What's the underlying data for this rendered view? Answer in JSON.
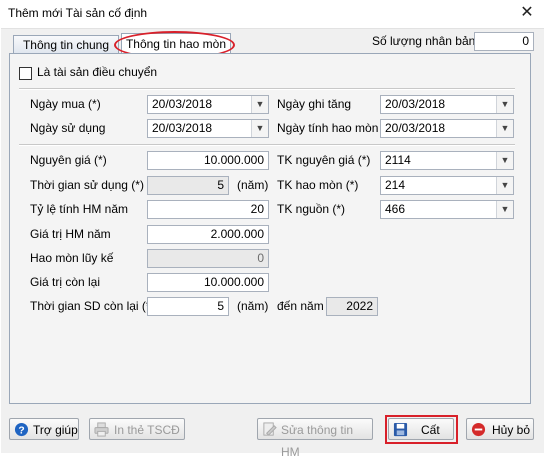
{
  "window": {
    "title": "Thêm mới Tài sản cố định",
    "close_glyph": "✕"
  },
  "tabs": [
    {
      "label": "Thông tin chung"
    },
    {
      "label": "Thông tin hao mòn"
    }
  ],
  "copies": {
    "label": "Số lượng nhân bản",
    "value": "0"
  },
  "transfer": {
    "label": "Là tài sản điều chuyển",
    "checked": false
  },
  "dates": {
    "purchase": {
      "label": "Ngày mua (*)",
      "value": "20/03/2018"
    },
    "increase": {
      "label": "Ngày ghi tăng",
      "value": "20/03/2018"
    },
    "use": {
      "label": "Ngày sử dụng",
      "value": "20/03/2018"
    },
    "depreciation": {
      "label": "Ngày tính hao mòn",
      "value": "20/03/2018"
    }
  },
  "values": {
    "original_cost": {
      "label": "Nguyên giá (*)",
      "value": "10.000.000"
    },
    "usage_time": {
      "label": "Thời gian sử dụng (*)",
      "value": "5",
      "unit": "(năm)"
    },
    "rate": {
      "label": "Tỷ lệ tính HM năm",
      "value": "20"
    },
    "annual_dep": {
      "label": "Giá trị HM năm",
      "value": "2.000.000"
    },
    "accumulated": {
      "label": "Hao mòn lũy kế",
      "value": "0"
    },
    "remaining_value": {
      "label": "Giá trị còn lại",
      "value": "10.000.000"
    },
    "remaining_time": {
      "label": "Thời gian SD còn lại (*)",
      "value": "5",
      "unit": "(năm)"
    },
    "end_year": {
      "label": "đến năm",
      "value": "2022"
    }
  },
  "accounts": {
    "original": {
      "label": "TK nguyên giá (*)",
      "value": "2114"
    },
    "depreciation": {
      "label": "TK hao mòn (*)",
      "value": "214"
    },
    "source": {
      "label": "TK nguồn (*)",
      "value": "466"
    }
  },
  "buttons": {
    "help": "Trợ giúp",
    "print": "In thẻ TSCĐ",
    "edit_dep": "Sửa thông tin HM",
    "save": "Cất",
    "cancel": "Hủy bỏ"
  },
  "colors": {
    "highlight": "#d8202a",
    "help_icon": "#1f64c2",
    "cancel_icon": "#d42a2a",
    "save_icon": "#2a5aa8"
  },
  "icons": [
    "help-icon",
    "print-icon",
    "edit-icon",
    "save-icon",
    "cancel-icon",
    "dropdown-arrow-icon"
  ]
}
